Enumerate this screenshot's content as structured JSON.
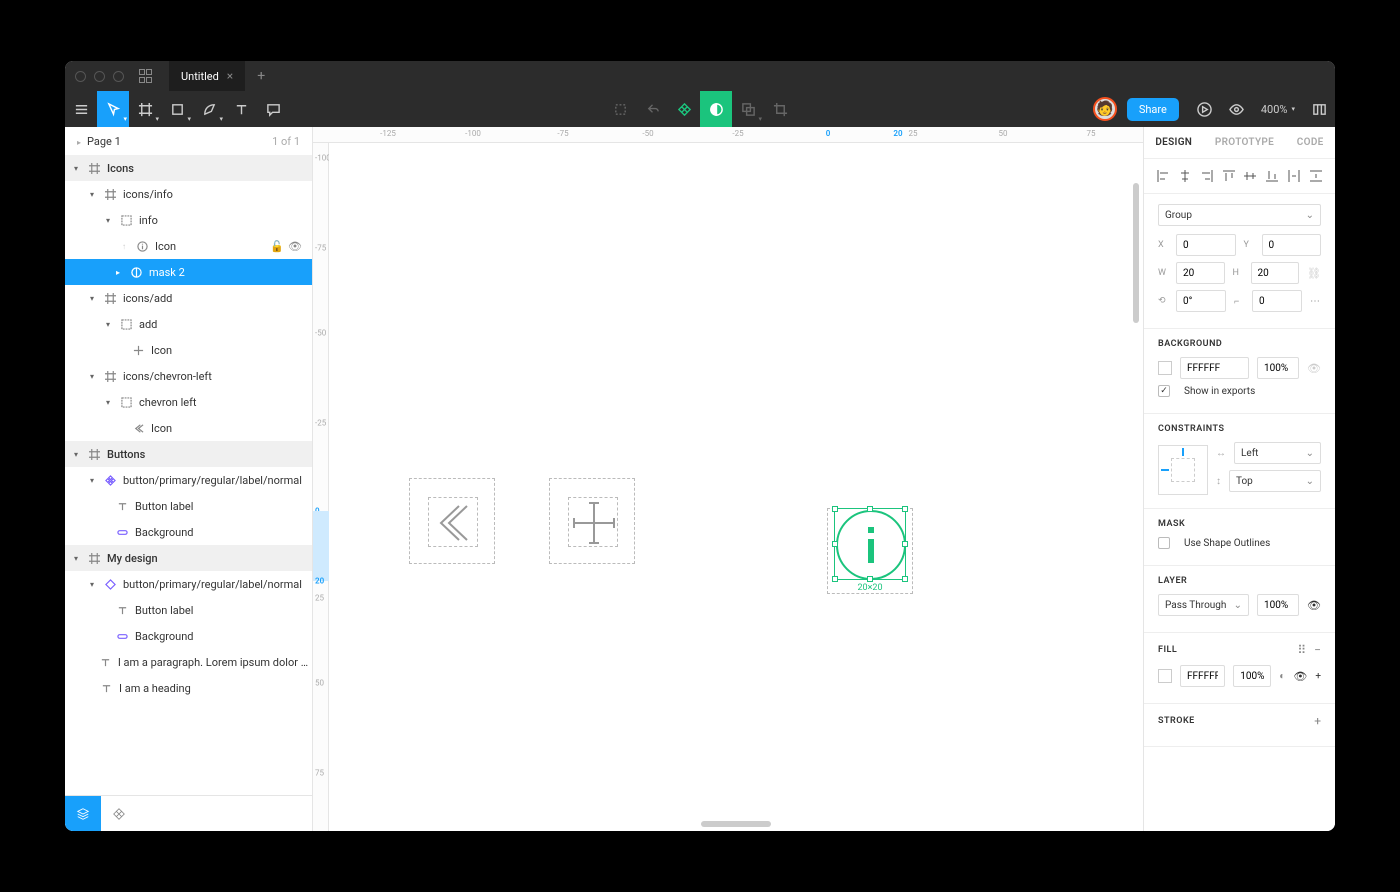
{
  "titlebar": {
    "tab_title": "Untitled"
  },
  "toolbar": {
    "share_label": "Share",
    "zoom": "400%"
  },
  "pages": {
    "label": "Page 1",
    "count": "1 of 1"
  },
  "layers": {
    "icons_frame": "Icons",
    "icons_info": "icons/info",
    "info": "info",
    "icon1": "Icon",
    "mask2": "mask 2",
    "icons_add": "icons/add",
    "add": "add",
    "icon2": "Icon",
    "icons_chev": "icons/chevron-left",
    "chev_left": "chevron left",
    "icon3": "Icon",
    "buttons_frame": "Buttons",
    "btn_main": "button/primary/regular/label/normal",
    "btn_lbl": "Button label",
    "btn_bg": "Background",
    "mydesign": "My design",
    "btn_inst": "button/primary/regular/label/normal",
    "btn_lbl2": "Button label",
    "btn_bg2": "Background",
    "para": "I am a paragraph. Lorem ipsum dolor sit a...",
    "heading": "I am a heading"
  },
  "ruler_h": {
    "m125": "-125",
    "m100": "-100",
    "m75": "-75",
    "m50": "-50",
    "m25": "-25",
    "z": "0",
    "p20": "20",
    "p25": "25",
    "p50": "50",
    "p75": "75"
  },
  "ruler_v": {
    "m100": "-100",
    "m75": "-75",
    "m50": "-50",
    "m25": "-25",
    "z": "0",
    "p20": "20",
    "p25": "25",
    "p50": "50",
    "p75": "75"
  },
  "canvas": {
    "sel_dim": "20×20"
  },
  "dtabs": {
    "design": "DESIGN",
    "prototype": "PROTOTYPE",
    "code": "CODE"
  },
  "design": {
    "group_type": "Group",
    "x": "0",
    "y": "0",
    "w": "20",
    "h": "20",
    "rot": "0°",
    "radius": "0",
    "bg_title": "BACKGROUND",
    "bg_hex": "FFFFFF",
    "bg_op": "100%",
    "show_exports": "Show in exports",
    "con_title": "CONSTRAINTS",
    "con_h": "Left",
    "con_v": "Top",
    "mask_title": "MASK",
    "mask_chk": "Use Shape Outlines",
    "layer_title": "LAYER",
    "blend": "Pass Through",
    "layer_op": "100%",
    "fill_title": "FILL",
    "fill_hex": "FFFFFF",
    "fill_op": "100%",
    "stroke_title": "STROKE"
  }
}
